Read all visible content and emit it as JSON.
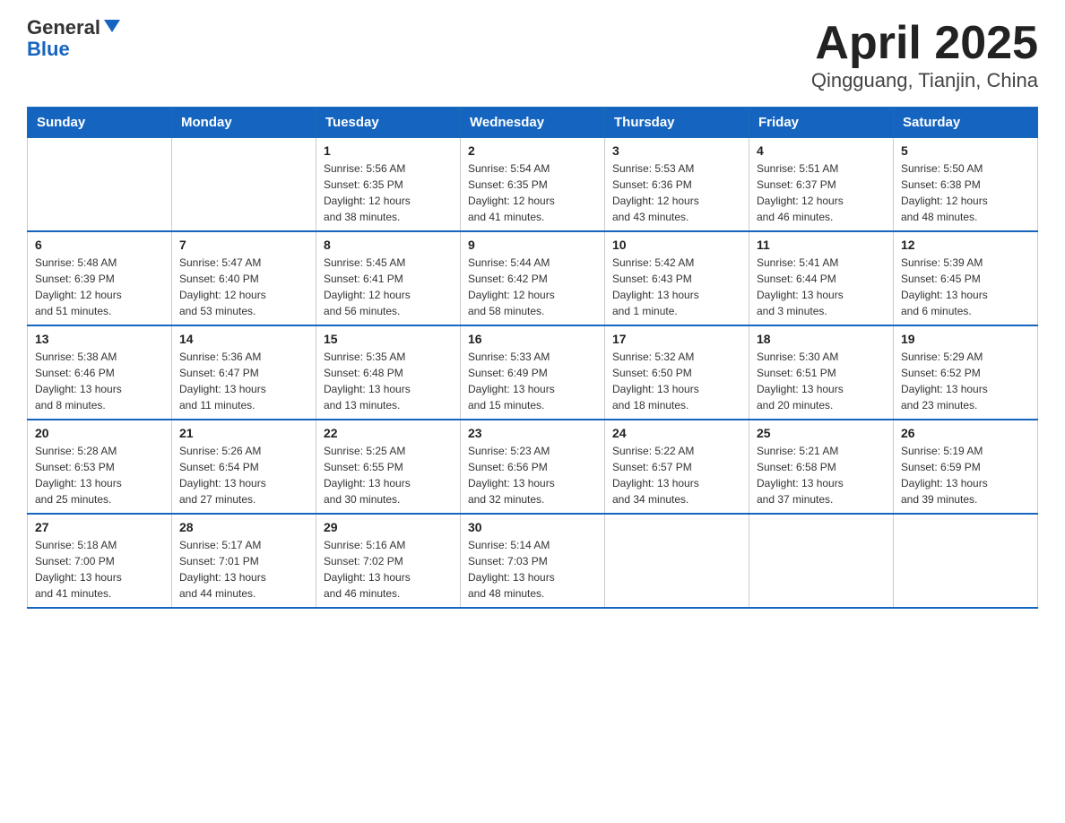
{
  "header": {
    "logo_line1": "General",
    "logo_line2": "Blue",
    "title": "April 2025",
    "subtitle": "Qingguang, Tianjin, China"
  },
  "weekdays": [
    "Sunday",
    "Monday",
    "Tuesday",
    "Wednesday",
    "Thursday",
    "Friday",
    "Saturday"
  ],
  "weeks": [
    [
      {
        "day": "",
        "info": ""
      },
      {
        "day": "",
        "info": ""
      },
      {
        "day": "1",
        "info": "Sunrise: 5:56 AM\nSunset: 6:35 PM\nDaylight: 12 hours\nand 38 minutes."
      },
      {
        "day": "2",
        "info": "Sunrise: 5:54 AM\nSunset: 6:35 PM\nDaylight: 12 hours\nand 41 minutes."
      },
      {
        "day": "3",
        "info": "Sunrise: 5:53 AM\nSunset: 6:36 PM\nDaylight: 12 hours\nand 43 minutes."
      },
      {
        "day": "4",
        "info": "Sunrise: 5:51 AM\nSunset: 6:37 PM\nDaylight: 12 hours\nand 46 minutes."
      },
      {
        "day": "5",
        "info": "Sunrise: 5:50 AM\nSunset: 6:38 PM\nDaylight: 12 hours\nand 48 minutes."
      }
    ],
    [
      {
        "day": "6",
        "info": "Sunrise: 5:48 AM\nSunset: 6:39 PM\nDaylight: 12 hours\nand 51 minutes."
      },
      {
        "day": "7",
        "info": "Sunrise: 5:47 AM\nSunset: 6:40 PM\nDaylight: 12 hours\nand 53 minutes."
      },
      {
        "day": "8",
        "info": "Sunrise: 5:45 AM\nSunset: 6:41 PM\nDaylight: 12 hours\nand 56 minutes."
      },
      {
        "day": "9",
        "info": "Sunrise: 5:44 AM\nSunset: 6:42 PM\nDaylight: 12 hours\nand 58 minutes."
      },
      {
        "day": "10",
        "info": "Sunrise: 5:42 AM\nSunset: 6:43 PM\nDaylight: 13 hours\nand 1 minute."
      },
      {
        "day": "11",
        "info": "Sunrise: 5:41 AM\nSunset: 6:44 PM\nDaylight: 13 hours\nand 3 minutes."
      },
      {
        "day": "12",
        "info": "Sunrise: 5:39 AM\nSunset: 6:45 PM\nDaylight: 13 hours\nand 6 minutes."
      }
    ],
    [
      {
        "day": "13",
        "info": "Sunrise: 5:38 AM\nSunset: 6:46 PM\nDaylight: 13 hours\nand 8 minutes."
      },
      {
        "day": "14",
        "info": "Sunrise: 5:36 AM\nSunset: 6:47 PM\nDaylight: 13 hours\nand 11 minutes."
      },
      {
        "day": "15",
        "info": "Sunrise: 5:35 AM\nSunset: 6:48 PM\nDaylight: 13 hours\nand 13 minutes."
      },
      {
        "day": "16",
        "info": "Sunrise: 5:33 AM\nSunset: 6:49 PM\nDaylight: 13 hours\nand 15 minutes."
      },
      {
        "day": "17",
        "info": "Sunrise: 5:32 AM\nSunset: 6:50 PM\nDaylight: 13 hours\nand 18 minutes."
      },
      {
        "day": "18",
        "info": "Sunrise: 5:30 AM\nSunset: 6:51 PM\nDaylight: 13 hours\nand 20 minutes."
      },
      {
        "day": "19",
        "info": "Sunrise: 5:29 AM\nSunset: 6:52 PM\nDaylight: 13 hours\nand 23 minutes."
      }
    ],
    [
      {
        "day": "20",
        "info": "Sunrise: 5:28 AM\nSunset: 6:53 PM\nDaylight: 13 hours\nand 25 minutes."
      },
      {
        "day": "21",
        "info": "Sunrise: 5:26 AM\nSunset: 6:54 PM\nDaylight: 13 hours\nand 27 minutes."
      },
      {
        "day": "22",
        "info": "Sunrise: 5:25 AM\nSunset: 6:55 PM\nDaylight: 13 hours\nand 30 minutes."
      },
      {
        "day": "23",
        "info": "Sunrise: 5:23 AM\nSunset: 6:56 PM\nDaylight: 13 hours\nand 32 minutes."
      },
      {
        "day": "24",
        "info": "Sunrise: 5:22 AM\nSunset: 6:57 PM\nDaylight: 13 hours\nand 34 minutes."
      },
      {
        "day": "25",
        "info": "Sunrise: 5:21 AM\nSunset: 6:58 PM\nDaylight: 13 hours\nand 37 minutes."
      },
      {
        "day": "26",
        "info": "Sunrise: 5:19 AM\nSunset: 6:59 PM\nDaylight: 13 hours\nand 39 minutes."
      }
    ],
    [
      {
        "day": "27",
        "info": "Sunrise: 5:18 AM\nSunset: 7:00 PM\nDaylight: 13 hours\nand 41 minutes."
      },
      {
        "day": "28",
        "info": "Sunrise: 5:17 AM\nSunset: 7:01 PM\nDaylight: 13 hours\nand 44 minutes."
      },
      {
        "day": "29",
        "info": "Sunrise: 5:16 AM\nSunset: 7:02 PM\nDaylight: 13 hours\nand 46 minutes."
      },
      {
        "day": "30",
        "info": "Sunrise: 5:14 AM\nSunset: 7:03 PM\nDaylight: 13 hours\nand 48 minutes."
      },
      {
        "day": "",
        "info": ""
      },
      {
        "day": "",
        "info": ""
      },
      {
        "day": "",
        "info": ""
      }
    ]
  ]
}
